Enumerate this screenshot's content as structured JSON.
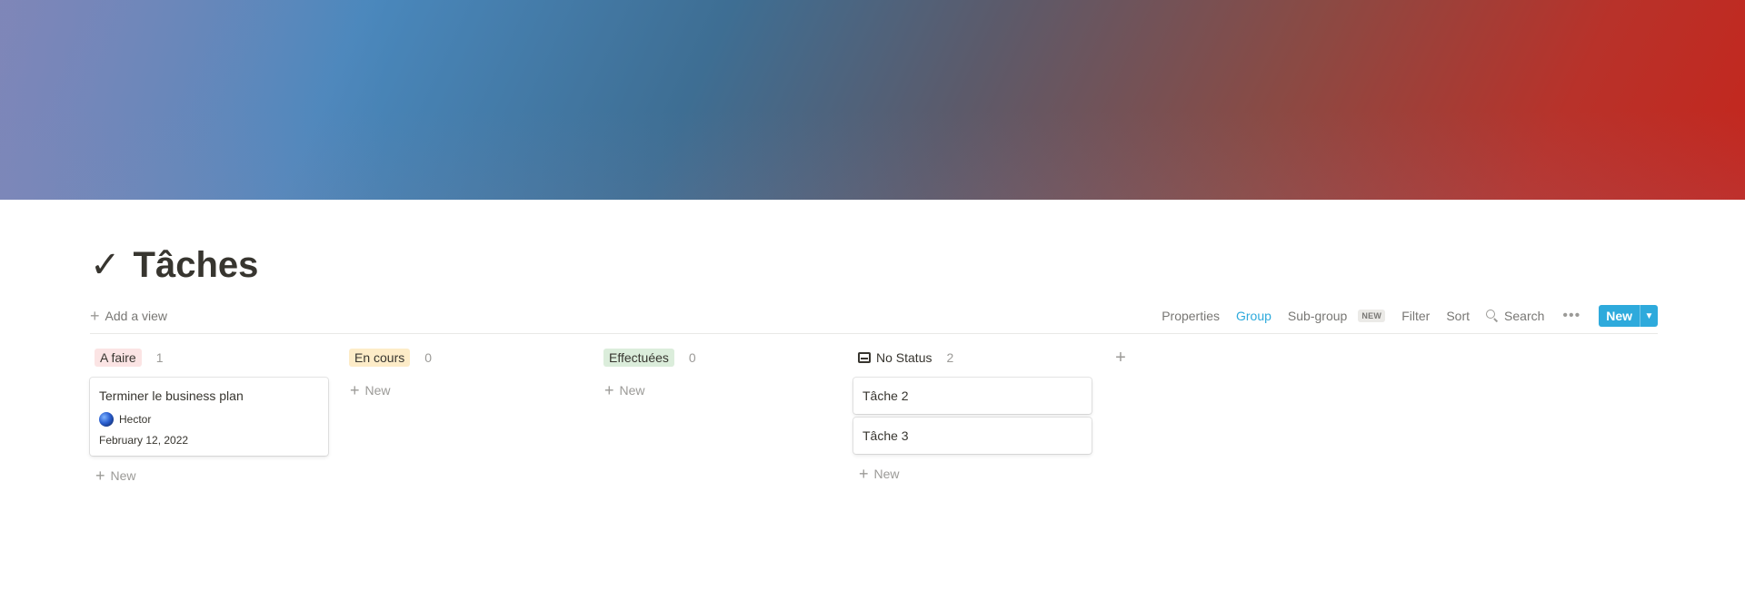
{
  "page": {
    "title_icon": "✓",
    "title": "Tâches"
  },
  "toolbar": {
    "add_view": "Add a view",
    "properties": "Properties",
    "group": "Group",
    "subgroup": "Sub-group",
    "subgroup_badge": "NEW",
    "filter": "Filter",
    "sort": "Sort",
    "search": "Search",
    "more": "•••",
    "new": "New",
    "accent_color": "#2eaadc"
  },
  "board": {
    "new_label": "New",
    "columns": [
      {
        "label": "A faire",
        "count": "1",
        "tag_color": "#fbe4e4",
        "cards": [
          {
            "title": "Terminer le business plan",
            "person": "Hector",
            "date": "February 12, 2022"
          }
        ]
      },
      {
        "label": "En cours",
        "count": "0",
        "tag_color": "#fdecc8",
        "cards": []
      },
      {
        "label": "Effectuées",
        "count": "0",
        "tag_color": "#dbeddb",
        "cards": []
      },
      {
        "label": "No Status",
        "count": "2",
        "cards": [
          {
            "title": "Tâche 2"
          },
          {
            "title": "Tâche 3"
          }
        ]
      }
    ]
  }
}
